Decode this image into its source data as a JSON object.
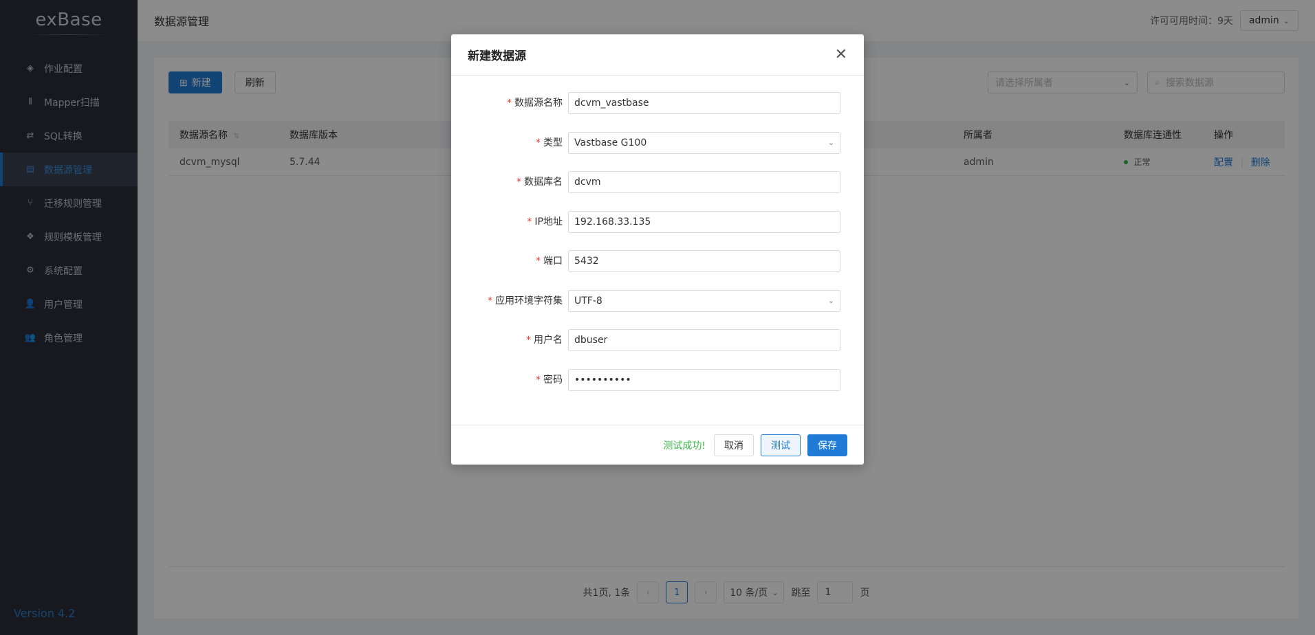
{
  "sidebar": {
    "logo": "exBase",
    "items": [
      {
        "label": "作业配置",
        "icon": "layers-icon"
      },
      {
        "label": "Mapper扫描",
        "icon": "scan-icon"
      },
      {
        "label": "SQL转换",
        "icon": "swap-icon"
      },
      {
        "label": "数据源管理",
        "icon": "database-icon",
        "active": true
      },
      {
        "label": "迁移规则管理",
        "icon": "branch-icon"
      },
      {
        "label": "规则模板管理",
        "icon": "template-icon"
      },
      {
        "label": "系统配置",
        "icon": "gear-icon"
      },
      {
        "label": "用户管理",
        "icon": "user-icon"
      },
      {
        "label": "角色管理",
        "icon": "users-icon"
      }
    ],
    "version": "Version 4.2"
  },
  "header": {
    "title": "数据源管理",
    "license": "许可可用时间：9天",
    "user": "admin"
  },
  "toolbar": {
    "new_label": "新建",
    "refresh_label": "刷新",
    "owner_placeholder": "请选择所属者",
    "search_placeholder": "搜索数据源"
  },
  "table": {
    "columns": [
      "数据源名称",
      "数据库版本",
      "所属者",
      "数据库连通性",
      "操作"
    ],
    "rows": [
      {
        "name": "dcvm_mysql",
        "version": "5.7.44",
        "owner": "admin",
        "status": "正常",
        "op_config": "配置",
        "op_delete": "删除"
      }
    ]
  },
  "pager": {
    "summary": "共1页, 1条",
    "prev": "‹",
    "current": "1",
    "next": "›",
    "page_size": "10 条/页",
    "jump_label": "跳至",
    "jump_value": "1",
    "page_suffix": "页"
  },
  "modal": {
    "title": "新建数据源",
    "fields": [
      {
        "label": "数据源名称",
        "value": "dcvm_vastbase",
        "type": "input"
      },
      {
        "label": "类型",
        "value": "Vastbase G100",
        "type": "select"
      },
      {
        "label": "数据库名",
        "value": "dcvm",
        "type": "input"
      },
      {
        "label": "IP地址",
        "value": "192.168.33.135",
        "type": "input"
      },
      {
        "label": "端口",
        "value": "5432",
        "type": "input"
      },
      {
        "label": "应用环境字符集",
        "value": "UTF-8",
        "type": "select"
      },
      {
        "label": "用户名",
        "value": "dbuser",
        "type": "input"
      },
      {
        "label": "密码",
        "value": "••••••••••",
        "type": "password"
      }
    ],
    "success": "测试成功!",
    "cancel": "取消",
    "test": "测试",
    "save": "保存"
  }
}
